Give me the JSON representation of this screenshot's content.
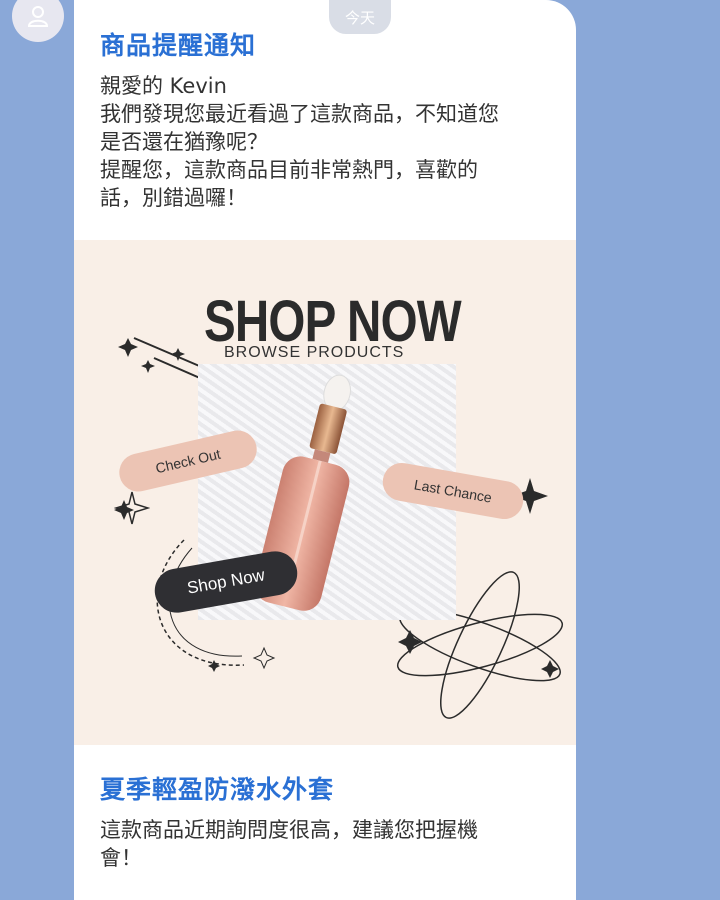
{
  "header": {
    "date_label": "今天",
    "avatar_icon": "user-icon"
  },
  "message": {
    "title": "商品提醒通知",
    "lines": [
      "親愛的 Kevin",
      "我們發現您最近看過了這款商品，不知道您\n是否還在猶豫呢？",
      "提醒您，這款商品目前非常熱門，喜歡的\n話，別錯過囉！"
    ]
  },
  "banner": {
    "headline": "SHOP NOW",
    "tagline": "BROWSE PRODUCTS",
    "tag_check_out": "Check Out",
    "tag_last_chance": "Last Chance",
    "button_shop_now": "Shop Now",
    "image_subject": "serum-bottle-image"
  },
  "product": {
    "name": "夏季輕盈防潑水外套",
    "description": "這款商品近期詢問度很高，建議您把握機\n會！"
  },
  "colors": {
    "background": "#8aa8d8",
    "accent_blue": "#2a70d4",
    "banner_bg": "#f9efe7",
    "tag_peach": "#ecc4b4",
    "button_dark": "#2f2f33"
  }
}
